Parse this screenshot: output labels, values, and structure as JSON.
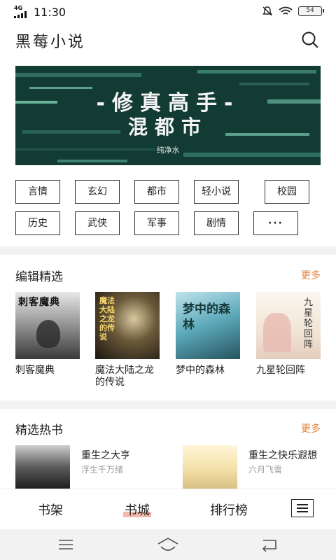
{
  "status_bar": {
    "network": "4G",
    "time": "11:30",
    "battery": "54"
  },
  "header": {
    "title": "黑莓小说"
  },
  "banner": {
    "title": "-修真高手-",
    "subtitle": "混都市",
    "author": "纯净水"
  },
  "categories": [
    "言情",
    "玄幻",
    "都市",
    "轻小说",
    "校园",
    "历史",
    "武侠",
    "军事",
    "剧情",
    "···"
  ],
  "editor_picks": {
    "title": "编辑精选",
    "more": "更多",
    "books": [
      {
        "name": "刺客魔典",
        "cover_text": "刺客魔典"
      },
      {
        "name": "魔法大陆之龙的传说",
        "cover_text": "魔法大陆之龙的传说"
      },
      {
        "name": "梦中的森林",
        "cover_text": "梦中的森林"
      },
      {
        "name": "九星轮回阵",
        "cover_text": "九星轮回阵"
      }
    ]
  },
  "hot_books": {
    "title": "精选热书",
    "more": "更多",
    "books": [
      {
        "name": "重生之大亨",
        "author": "浮生千万绪"
      },
      {
        "name": "重生之快乐遐想",
        "author": "六月飞雪"
      }
    ]
  },
  "bottom_tabs": {
    "items": [
      "书架",
      "书城",
      "排行榜"
    ],
    "active": "书城"
  },
  "colors": {
    "accent": "#e0823a",
    "banner_bg": "#123b34",
    "tab_highlight": "#f0a89a"
  }
}
